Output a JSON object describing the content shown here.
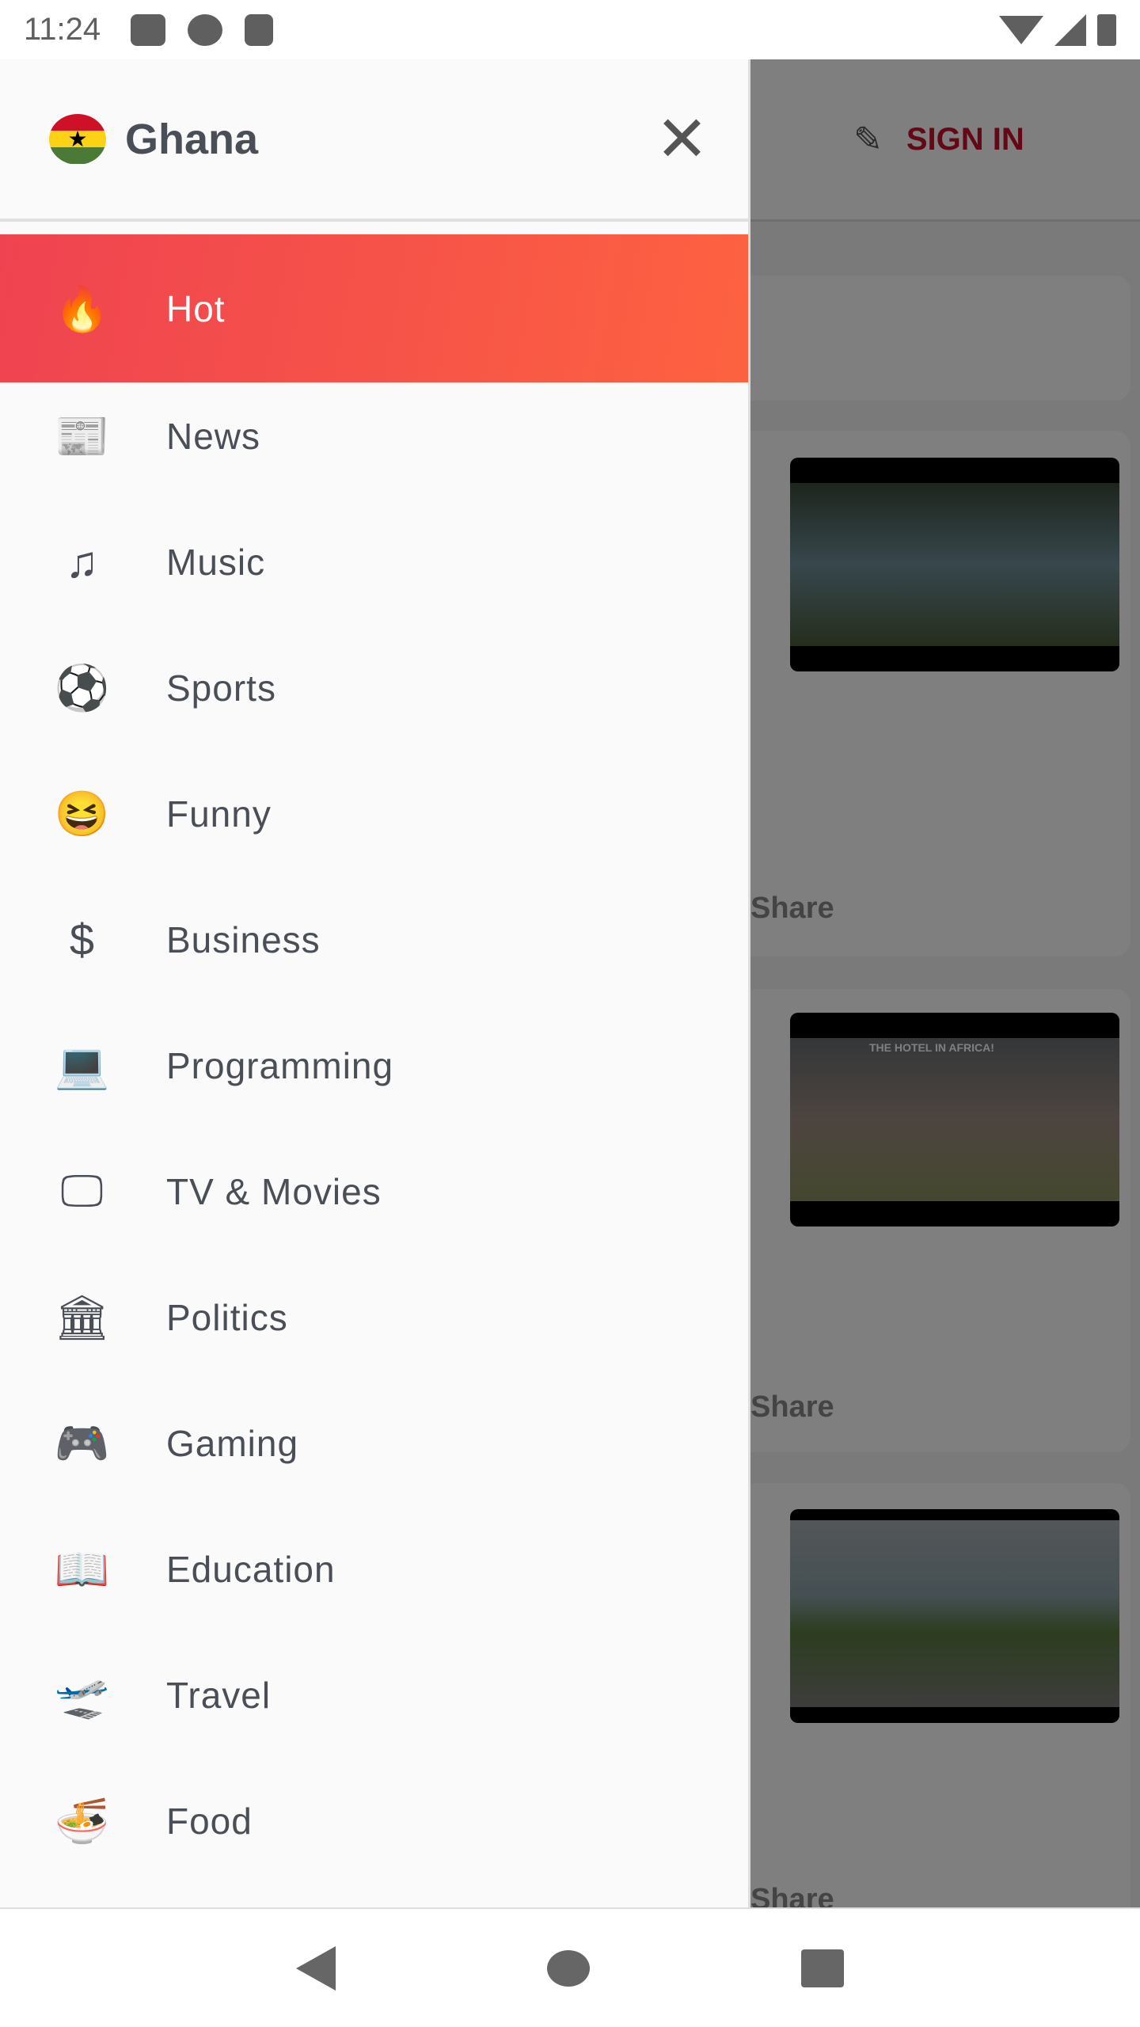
{
  "status_bar": {
    "time": "11:24",
    "left_icons": [
      "youtube-icon",
      "app-icon",
      "sd-card-icon"
    ],
    "right_icons": [
      "wifi-icon",
      "signal-icon",
      "battery-icon"
    ]
  },
  "drawer": {
    "title": "Ghana",
    "flag": "ghana-flag",
    "close_icon": "close-icon",
    "items": [
      {
        "label": "Hot",
        "icon": "fire-icon",
        "glyph": "🔥",
        "active": true
      },
      {
        "label": "News",
        "icon": "newspaper-icon",
        "glyph": "📰"
      },
      {
        "label": "Music",
        "icon": "music-note-icon",
        "glyph": "♫"
      },
      {
        "label": "Sports",
        "icon": "soccer-ball-icon",
        "glyph": "⚽"
      },
      {
        "label": "Funny",
        "icon": "laughing-face-icon",
        "glyph": "😆"
      },
      {
        "label": "Business",
        "icon": "dollar-icon",
        "glyph": "$"
      },
      {
        "label": "Programming",
        "icon": "laptop-code-icon",
        "glyph": "💻"
      },
      {
        "label": "TV & Movies",
        "icon": "tv-icon",
        "glyph": "🖵"
      },
      {
        "label": "Politics",
        "icon": "government-building-icon",
        "glyph": "🏛"
      },
      {
        "label": "Gaming",
        "icon": "gamepad-icon",
        "glyph": "🎮"
      },
      {
        "label": "Education",
        "icon": "book-icon",
        "glyph": "📖"
      },
      {
        "label": "Travel",
        "icon": "plane-departure-icon",
        "glyph": "🛫"
      },
      {
        "label": "Food",
        "icon": "bowl-icon",
        "glyph": "🍜"
      }
    ]
  },
  "background": {
    "sign_in": "SIGN IN",
    "cards": [
      {
        "share": "Share"
      },
      {
        "share": "Share",
        "caption": "THE HOTEL IN AFRICA!"
      },
      {
        "share": "Share"
      }
    ]
  },
  "colors": {
    "accent_start": "#ef4351",
    "accent_end": "#fd6240",
    "sign_in": "#c8102e"
  }
}
